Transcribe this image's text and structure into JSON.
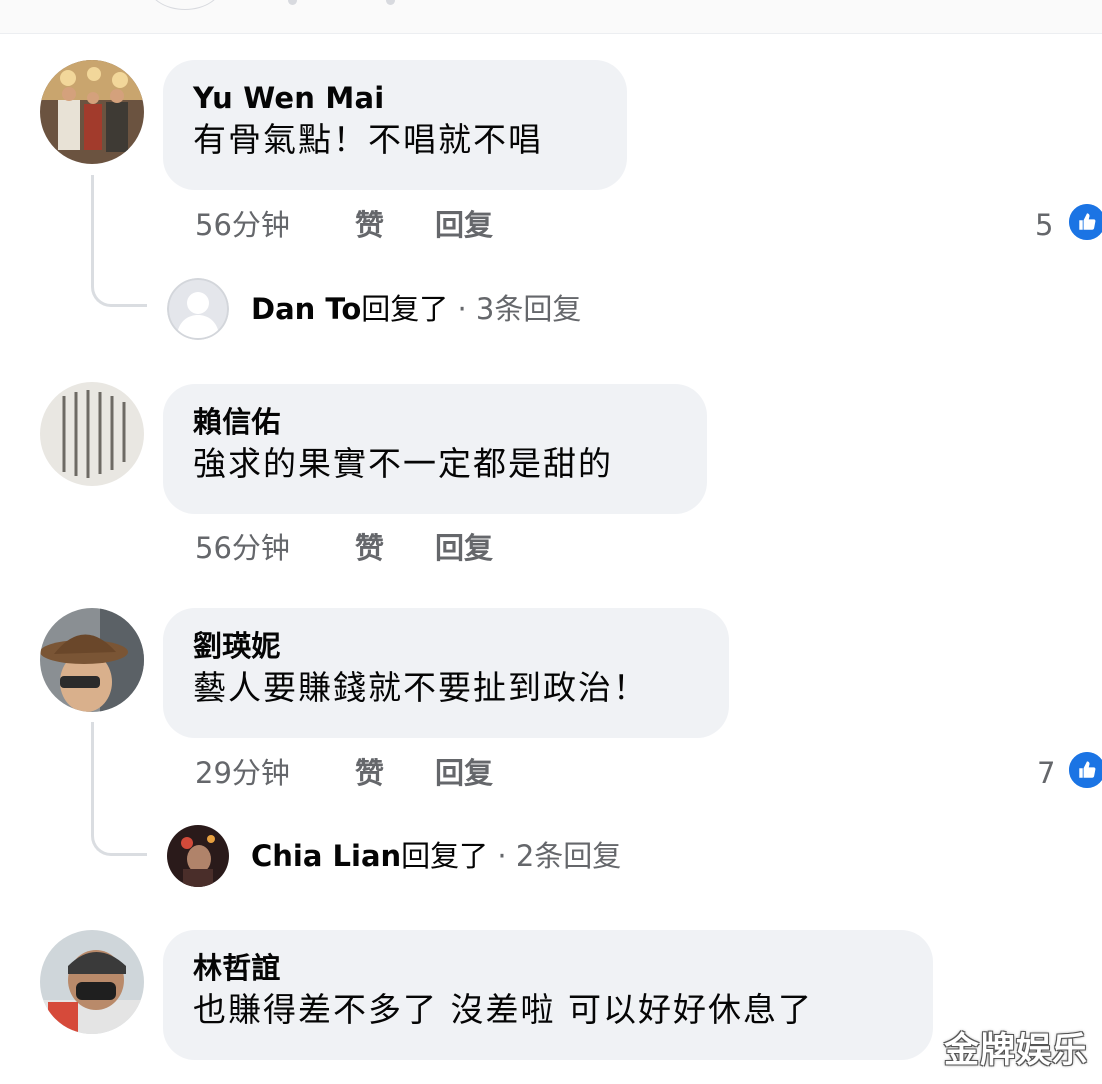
{
  "comments": [
    {
      "author": "Yu Wen Mai",
      "text": "有骨氣點！不唱就不唱",
      "time": "56分钟",
      "like_label": "赞",
      "reply_label": "回复",
      "reaction_count": "5",
      "replies_preview": {
        "name": "Dan To",
        "suffix": "回复了",
        "count": "· 3条回复"
      }
    },
    {
      "author": "賴信佑",
      "text": "強求的果實不一定都是甜的",
      "time": "56分钟",
      "like_label": "赞",
      "reply_label": "回复"
    },
    {
      "author": "劉瑛妮",
      "text": "藝人要賺錢就不要扯到政治！",
      "time": "29分钟",
      "like_label": "赞",
      "reply_label": "回复",
      "reaction_count": "7",
      "replies_preview": {
        "name": "Chia Lian",
        "suffix": "回复了",
        "count": "· 2条回复"
      }
    },
    {
      "author": "林哲誼",
      "text": "也賺得差不多了 沒差啦 可以好好休息了"
    }
  ],
  "watermark": "金牌娱乐",
  "colors": {
    "bubble": "#f0f2f5",
    "meta": "#65676b",
    "like_blue": "#1b74e4"
  },
  "icons": {
    "reaction": "thumbs-up-icon"
  }
}
